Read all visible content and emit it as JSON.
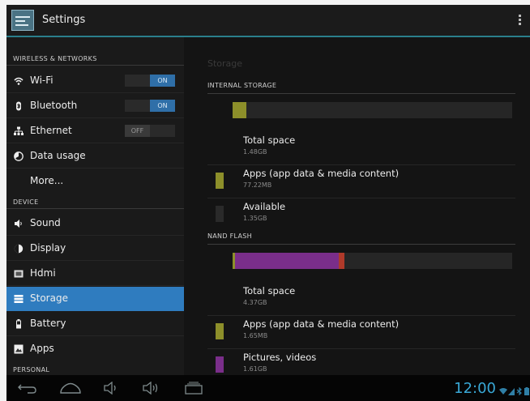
{
  "header": {
    "title": "Settings",
    "app_icon": "settings-icon",
    "overflow_icon": "overflow-menu-icon"
  },
  "sidebar": {
    "sections": [
      {
        "label": "WIRELESS & NETWORKS"
      },
      {
        "label": "DEVICE"
      },
      {
        "label": "PERSONAL"
      }
    ],
    "items": [
      {
        "label": "Wi-Fi",
        "icon": "wifi-icon",
        "toggle": "ON"
      },
      {
        "label": "Bluetooth",
        "icon": "bluetooth-icon",
        "toggle": "ON"
      },
      {
        "label": "Ethernet",
        "icon": "ethernet-icon",
        "toggle": "OFF"
      },
      {
        "label": "Data usage",
        "icon": "data-usage-icon"
      },
      {
        "label": "More..."
      },
      {
        "label": "Sound",
        "icon": "sound-icon"
      },
      {
        "label": "Display",
        "icon": "display-icon"
      },
      {
        "label": "Hdmi",
        "icon": "hdmi-icon"
      },
      {
        "label": "Storage",
        "icon": "storage-icon",
        "selected": true
      },
      {
        "label": "Battery",
        "icon": "battery-icon"
      },
      {
        "label": "Apps",
        "icon": "apps-icon"
      }
    ]
  },
  "main": {
    "title": "Storage",
    "internal": {
      "header": "INTERNAL STORAGE",
      "usage": [
        {
          "name": "apps",
          "fraction": 0.05,
          "color": "#8d8f2a"
        }
      ],
      "rows": [
        {
          "title": "Total space",
          "value": "1.48GB"
        },
        {
          "title": "Apps (app data & media content)",
          "value": "77.22MB",
          "color": "#8d8f2a"
        },
        {
          "title": "Available",
          "value": "1.35GB",
          "color": "#2a2a2a"
        }
      ]
    },
    "nand": {
      "header": "NAND FLASH",
      "usage": [
        {
          "name": "apps",
          "fraction": 0.01,
          "color": "#8d8f2a"
        },
        {
          "name": "pictures",
          "fraction": 0.37,
          "color": "#7a2e8a"
        },
        {
          "name": "other",
          "fraction": 0.02,
          "color": "#b03a2a"
        }
      ],
      "rows": [
        {
          "title": "Total space",
          "value": "4.37GB"
        },
        {
          "title": "Apps (app data & media content)",
          "value": "1.65MB",
          "color": "#8d8f2a"
        },
        {
          "title": "Pictures, videos",
          "value": "1.61GB",
          "color": "#7a2e8a"
        }
      ]
    }
  },
  "navbar": {
    "clock": "12:00",
    "buttons": [
      "back-icon",
      "home-icon",
      "volume-down-icon",
      "volume-up-icon",
      "recent-apps-icon"
    ],
    "accent": "#39a8d6"
  }
}
